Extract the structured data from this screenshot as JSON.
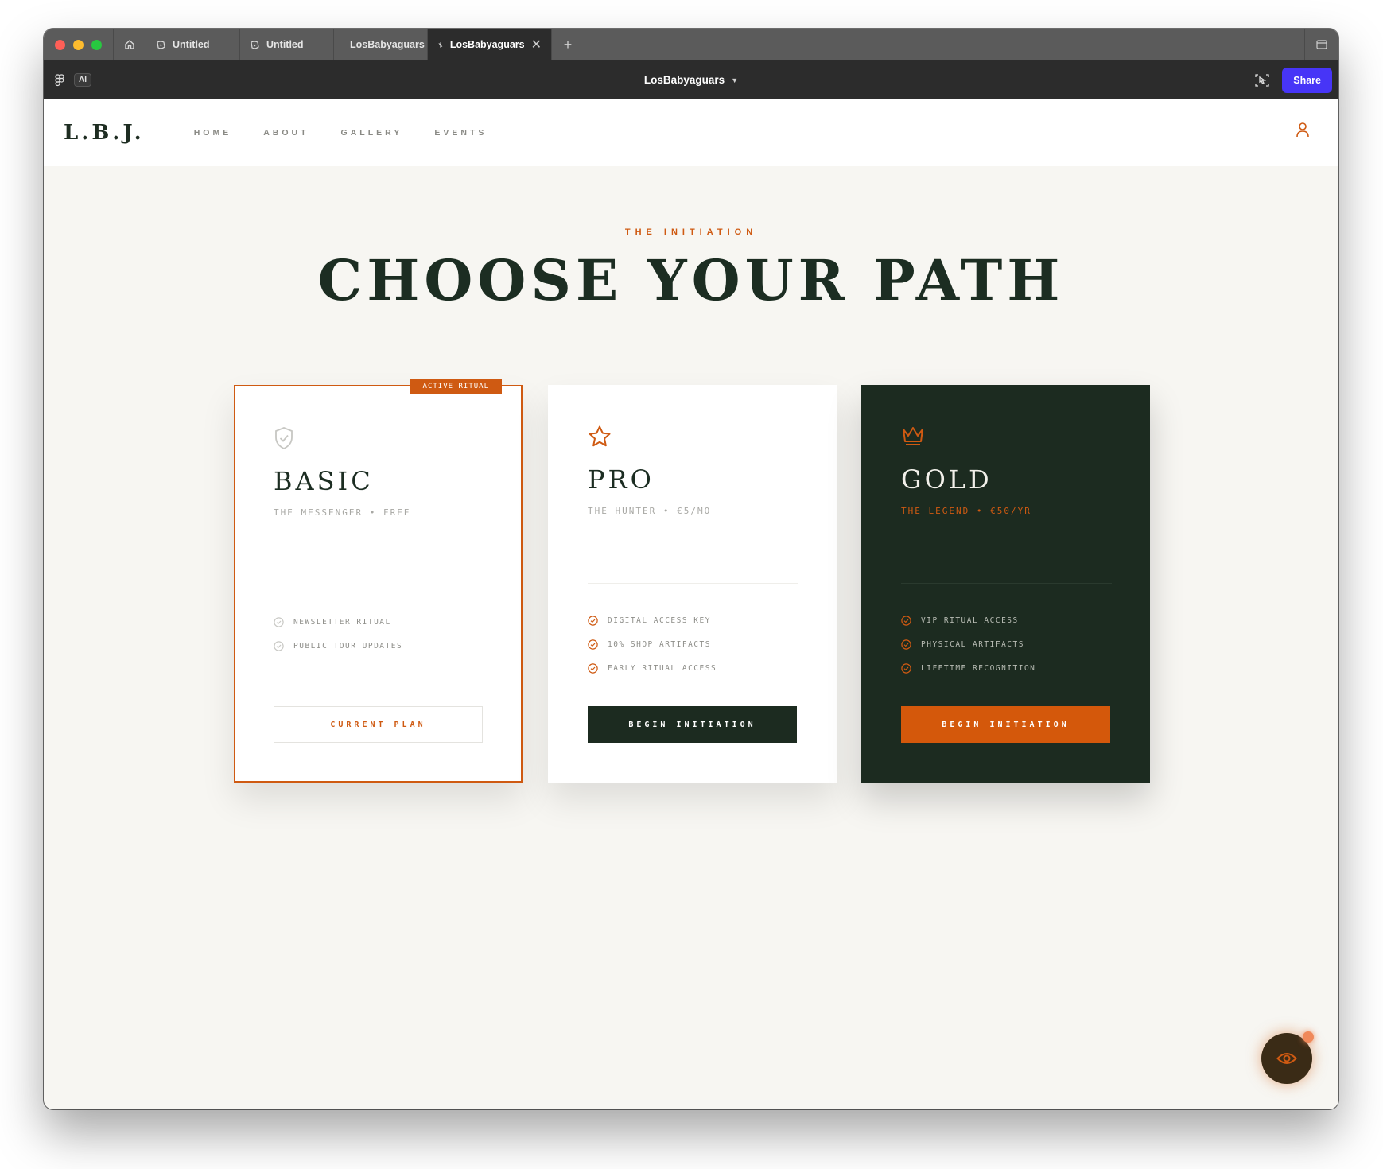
{
  "browser": {
    "tabs": [
      {
        "label": "Untitled",
        "icon": "figjam-icon"
      },
      {
        "label": "Untitled",
        "icon": "figjam-icon"
      },
      {
        "label": "LosBabyaguars",
        "icon": "make-icon"
      },
      {
        "label": "LosBabyaguars",
        "icon": "make-icon",
        "active": true
      }
    ],
    "new_tab_icon": "plus-icon"
  },
  "toolbar": {
    "ai_label": "AI",
    "doc_title": "LosBabyaguars",
    "share_label": "Share"
  },
  "site": {
    "logo": "L.B.J.",
    "nav": [
      "HOME",
      "ABOUT",
      "GALLERY",
      "EVENTS"
    ]
  },
  "hero": {
    "eyebrow": "THE INITIATION",
    "title": "CHOOSE YOUR PATH"
  },
  "plans": [
    {
      "name": "BASIC",
      "subtitle": "THE MESSENGER • FREE",
      "badge": "ACTIVE RITUAL",
      "icon": "shield-check-icon",
      "features": [
        "NEWSLETTER RITUAL",
        "PUBLIC TOUR UPDATES"
      ],
      "cta": "CURRENT PLAN"
    },
    {
      "name": "PRO",
      "subtitle": "THE HUNTER • €5/MO",
      "icon": "star-icon",
      "features": [
        "DIGITAL ACCESS KEY",
        "10% SHOP ARTIFACTS",
        "EARLY RITUAL ACCESS"
      ],
      "cta": "BEGIN INITIATION"
    },
    {
      "name": "GOLD",
      "subtitle": "THE LEGEND • €50/YR",
      "icon": "crown-icon",
      "features": [
        "VIP RITUAL ACCESS",
        "PHYSICAL ARTIFACTS",
        "LIFETIME RECOGNITION"
      ],
      "cta": "BEGIN INITIATION"
    }
  ],
  "colors": {
    "accent": "#cf5a12",
    "dark_green": "#1c2b20",
    "background": "#f7f6f2",
    "share_blue": "#4735f7"
  }
}
